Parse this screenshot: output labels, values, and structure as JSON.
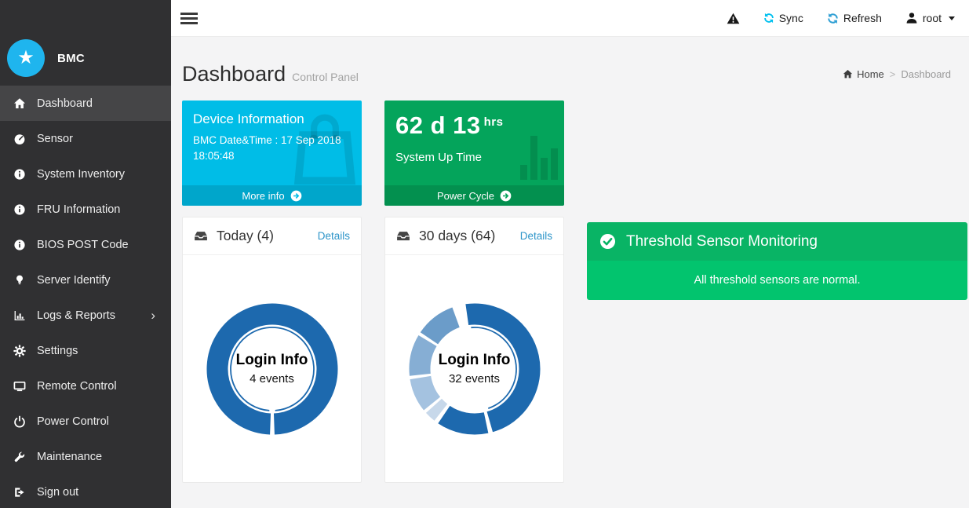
{
  "brand": {
    "name": "BMC"
  },
  "topbar": {
    "sync_label": "Sync",
    "refresh_label": "Refresh",
    "user_name": "root"
  },
  "page": {
    "title": "Dashboard",
    "subtitle": "Control Panel"
  },
  "breadcrumb": {
    "home": "Home",
    "separator": ">",
    "current": "Dashboard"
  },
  "sidebar": {
    "items": [
      {
        "label": "Dashboard",
        "icon": "home-icon",
        "active": true
      },
      {
        "label": "Sensor",
        "icon": "gauge-icon"
      },
      {
        "label": "System Inventory",
        "icon": "info-icon"
      },
      {
        "label": "FRU Information",
        "icon": "info-icon"
      },
      {
        "label": "BIOS POST Code",
        "icon": "info-icon"
      },
      {
        "label": "Server Identify",
        "icon": "bulb-icon"
      },
      {
        "label": "Logs & Reports",
        "icon": "bar-chart-icon",
        "submenu": true
      },
      {
        "label": "Settings",
        "icon": "gear-icon"
      },
      {
        "label": "Remote Control",
        "icon": "monitor-icon"
      },
      {
        "label": "Power Control",
        "icon": "power-icon"
      },
      {
        "label": "Maintenance",
        "icon": "wrench-icon"
      },
      {
        "label": "Sign out",
        "icon": "signout-icon"
      }
    ]
  },
  "device_card": {
    "title": "Device Information",
    "line1": "BMC Date&Time : 17 Sep 2018",
    "line2": "18:05:48",
    "footer_label": "More info",
    "bg": "#00bde7"
  },
  "uptime_card": {
    "value": "62 d 13",
    "unit": "hrs",
    "label": "System Up Time",
    "footer_label": "Power Cycle",
    "bg": "#04a45b"
  },
  "threshold_banner": {
    "title": "Threshold Sensor Monitoring",
    "message": "All threshold sensors are normal.",
    "header_bg": "#09b465",
    "body_bg": "#02c46e"
  },
  "chart_data": [
    {
      "type": "donut",
      "card_title": "Today (4)",
      "details_label": "Details",
      "center_label": "Login Info",
      "center_sub": "4 events",
      "total_events": 4,
      "segments": [
        {
          "start": 182,
          "end": 538,
          "color": "#1d69ae",
          "note": "all 4 login events"
        }
      ],
      "inner_arc": {
        "start": 184,
        "end": 536
      }
    },
    {
      "type": "donut",
      "card_title": "30 days (64)",
      "details_label": "Details",
      "center_label": "Login Info",
      "center_sub": "32 events",
      "total_events": 32,
      "segments": [
        {
          "start": -8,
          "end": 164,
          "color": "#1d69ae"
        },
        {
          "start": 168,
          "end": 214,
          "color": "#1d69ae"
        },
        {
          "start": 218,
          "end": 228,
          "color": "#c7d8ea"
        },
        {
          "start": 231,
          "end": 261,
          "color": "#a4c2e0"
        },
        {
          "start": 264,
          "end": 301,
          "color": "#86aed4"
        },
        {
          "start": 304,
          "end": 340,
          "color": "#6b9cc9"
        }
      ],
      "inner_arc": {
        "start": -5,
        "end": 161
      }
    }
  ]
}
